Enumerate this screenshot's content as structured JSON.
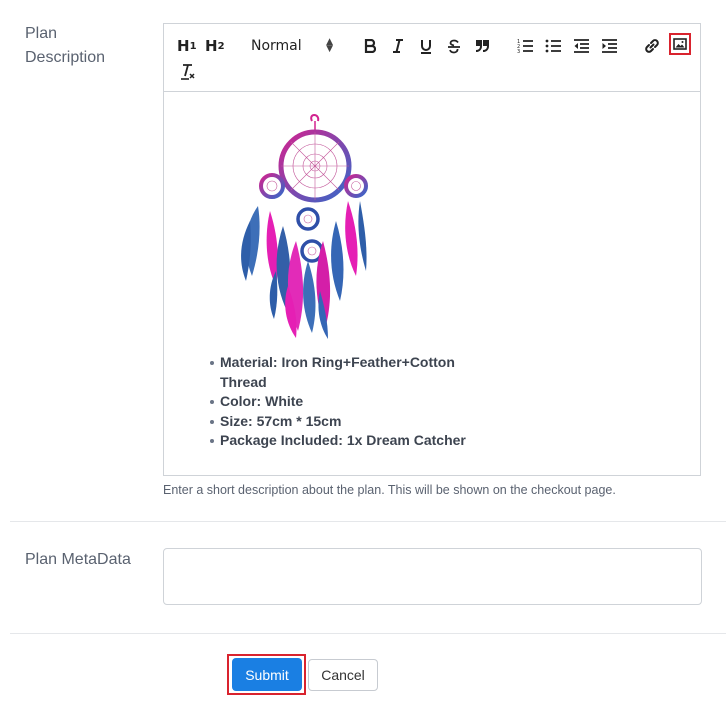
{
  "plan_description": {
    "label_line1": "Plan",
    "label_line2": "Description",
    "help_text": "Enter a short description about the plan. This will be shown on the checkout page."
  },
  "toolbar": {
    "h1": "H",
    "h1_sub": "1",
    "h2": "H",
    "h2_sub": "2",
    "format_select": "Normal",
    "icons": [
      "bold-icon",
      "italic-icon",
      "underline-icon",
      "strikethrough-icon",
      "blockquote-icon",
      "ordered-list-icon",
      "bullet-list-icon",
      "outdent-icon",
      "indent-icon",
      "link-icon",
      "image-icon",
      "clear-format-icon"
    ]
  },
  "editor_content": {
    "image": "dream-catcher-image",
    "bullets": [
      "Material: Iron Ring+Feather+Cotton Thread",
      "Color: White",
      "Size: 57cm * 15cm",
      "Package Included: 1x Dream Catcher"
    ]
  },
  "plan_metadata": {
    "label": "Plan MetaData",
    "value": ""
  },
  "actions": {
    "submit_label": "Submit",
    "cancel_label": "Cancel"
  },
  "colors": {
    "primary": "#1a7fe3",
    "highlight": "#d9232e",
    "border": "#cfd3d8"
  }
}
